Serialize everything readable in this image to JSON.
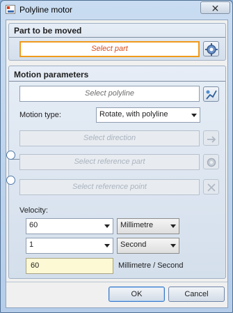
{
  "window": {
    "title": "Polyline motor",
    "close_glyph": "✕",
    "icon": "app-icon"
  },
  "part_group": {
    "title": "Part to be moved",
    "select_part": "Select part",
    "button_icon": "gear-select-icon"
  },
  "motion_group": {
    "title": "Motion parameters",
    "select_polyline": "Select polyline",
    "polyline_icon": "polyline-select-icon",
    "motion_type_label": "Motion type:",
    "motion_type_value": "Rotate, with polyline",
    "select_direction": "Select direction",
    "direction_icon": "direction-arrow-icon",
    "select_reference_part": "Select reference part",
    "reference_part_icon": "gear-icon",
    "select_reference_point": "Select reference point",
    "reference_point_icon": "point-arrow-icon",
    "velocity_label": "Velocity:",
    "velocity_value": "60",
    "velocity_unit": "Millimetre",
    "time_value": "1",
    "time_unit": "Second",
    "result_value": "60",
    "result_unit": "Millimetre / Second"
  },
  "footer": {
    "ok": "OK",
    "cancel": "Cancel"
  }
}
